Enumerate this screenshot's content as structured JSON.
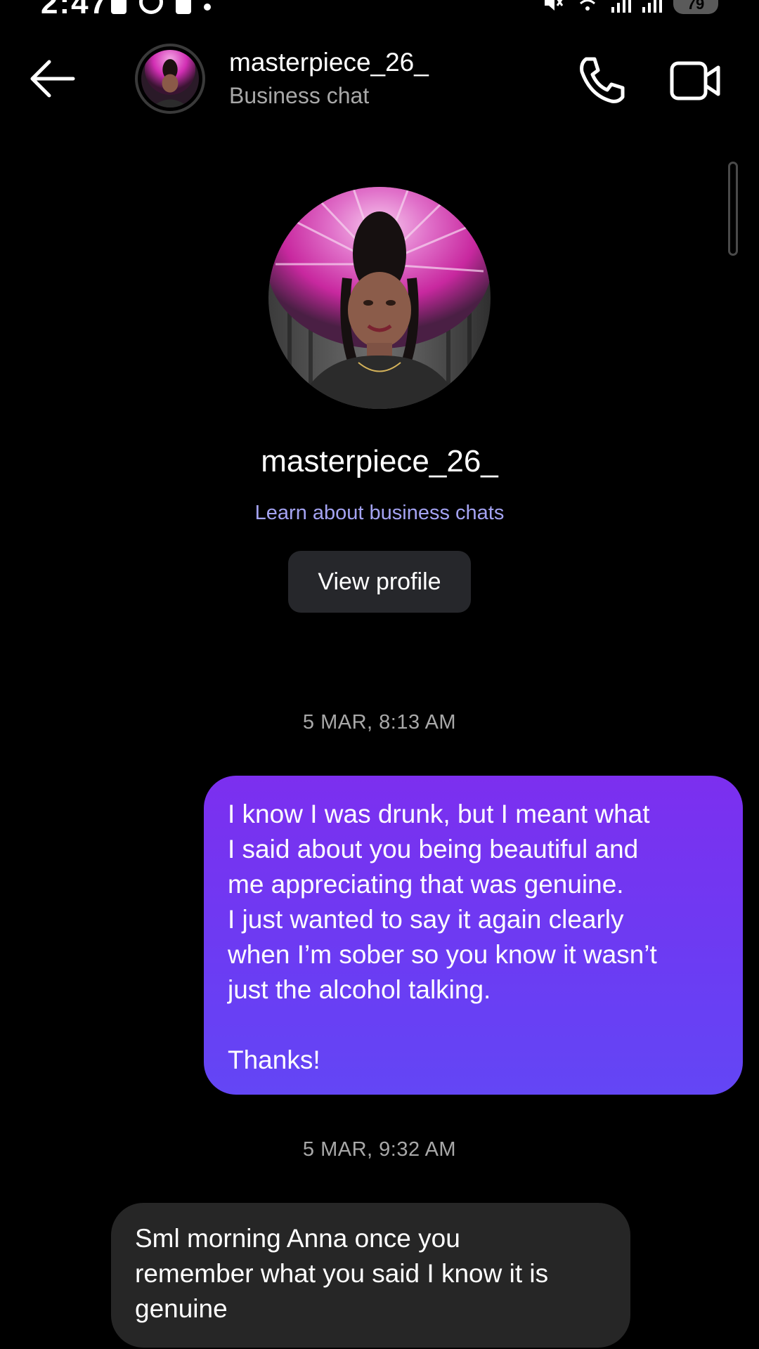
{
  "status_bar": {
    "time": "2:47",
    "battery": "79"
  },
  "header": {
    "username": "masterpiece_26_",
    "subtitle": "Business chat",
    "icons": {
      "back": "arrow-left-icon",
      "call": "phone-icon",
      "video": "video-camera-icon"
    }
  },
  "profile": {
    "username": "masterpiece_26_",
    "learn_link": "Learn about business chats",
    "view_profile_label": "View profile"
  },
  "messages": [
    {
      "timestamp": "5 MAR, 8:13 AM",
      "direction": "sent",
      "text": "I know I was drunk, but I meant what\nI said about you being beautiful and\nme appreciating that was genuine.\nI just wanted to say it again clearly\nwhen I’m sober so you know it wasn’t\njust the alcohol talking.\n\nThanks!"
    },
    {
      "timestamp": "5 MAR, 9:32 AM",
      "direction": "received",
      "text": "Sml morning Anna once you\nremember what you said I know it is\ngenuine"
    }
  ],
  "colors": {
    "background": "#000000",
    "sent_bubble_top": "#7c2fef",
    "sent_bubble_bottom": "#6346f5",
    "received_bubble": "#262626",
    "link": "#a4a3f2",
    "secondary_text": "#a8a8a8"
  }
}
